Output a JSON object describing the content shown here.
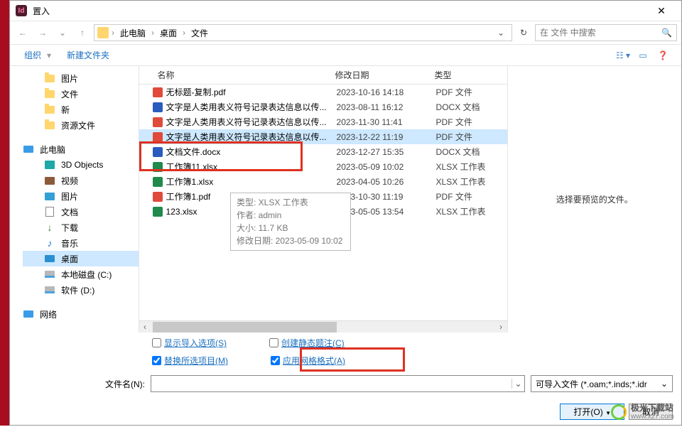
{
  "title": "置入",
  "path": {
    "root": "此电脑",
    "seg1": "桌面",
    "seg2": "文件"
  },
  "search": {
    "placeholder": "在 文件 中搜索"
  },
  "toolbar": {
    "organize": "组织",
    "newfolder": "新建文件夹"
  },
  "columns": {
    "name": "名称",
    "date": "修改日期",
    "type": "类型"
  },
  "sidebar": {
    "pics": "图片",
    "files": "文件",
    "new": "新",
    "res": "资源文件",
    "thispc": "此电脑",
    "obj3d": "3D Objects",
    "video": "视频",
    "images": "图片",
    "docs": "文档",
    "downloads": "下载",
    "music": "音乐",
    "desktop": "桌面",
    "diskc": "本地磁盘 (C:)",
    "diskd": "软件 (D:)",
    "net": "网络"
  },
  "files": [
    {
      "icon": "pdf",
      "name": "无标题-复制.pdf",
      "date": "2023-10-16 14:18",
      "type": "PDF 文件"
    },
    {
      "icon": "word",
      "name": "文字是人类用表义符号记录表达信息以传...",
      "date": "2023-08-11 16:12",
      "type": "DOCX 文档"
    },
    {
      "icon": "pdf",
      "name": "文字是人类用表义符号记录表达信息以传...",
      "date": "2023-11-30 11:41",
      "type": "PDF 文件"
    },
    {
      "icon": "pdf",
      "name": "文字是人类用表义符号记录表达信息以传...",
      "date": "2023-12-22 11:19",
      "type": "PDF 文件",
      "sel": true
    },
    {
      "icon": "word",
      "name": "文档文件.docx",
      "date": "2023-12-27 15:35",
      "type": "DOCX 文档"
    },
    {
      "icon": "xlsx",
      "name": "工作簿11.xlsx",
      "date": "2023-05-09 10:02",
      "type": "XLSX 工作表"
    },
    {
      "icon": "xlsx",
      "name": "工作簿1.xlsx",
      "date": "2023-04-05 10:26",
      "type": "XLSX 工作表"
    },
    {
      "icon": "pdf",
      "name": "工作簿1.pdf",
      "date": "2023-10-30 11:19",
      "type": "PDF 文件"
    },
    {
      "icon": "xlsx",
      "name": "123.xlsx",
      "date": "2023-05-05 13:54",
      "type": "XLSX 工作表"
    }
  ],
  "tooltip": {
    "l1": "类型: XLSX 工作表",
    "l2": "作者: admin",
    "l3": "大小: 11.7 KB",
    "l4": "修改日期: 2023-05-09 10:02"
  },
  "preview": "选择要预览的文件。",
  "options": {
    "showimport": "显示导入选项(S)",
    "createstatic": "创建静态题注(C)",
    "replacesel": "替换所选项目(M)",
    "applygrid": "应用网格格式(A)"
  },
  "filename": {
    "label": "文件名(N):"
  },
  "filter": "可导入文件 (*.oam;*.inds;*.idr",
  "buttons": {
    "open": "打开(O)",
    "cancel": "取消"
  },
  "watermark": {
    "t1": "极光下载站",
    "t2": "www.xz7.com"
  }
}
